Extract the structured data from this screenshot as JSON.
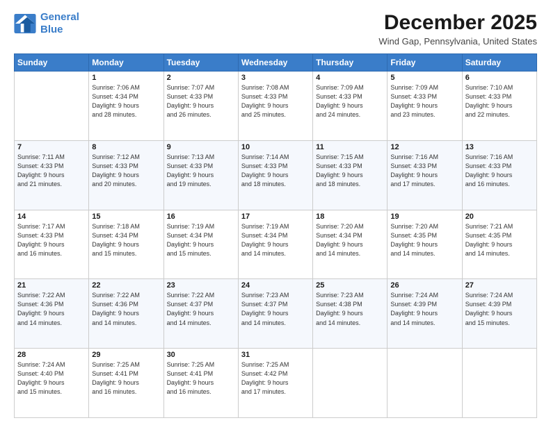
{
  "logo": {
    "line1": "General",
    "line2": "Blue"
  },
  "title": "December 2025",
  "subtitle": "Wind Gap, Pennsylvania, United States",
  "header_days": [
    "Sunday",
    "Monday",
    "Tuesday",
    "Wednesday",
    "Thursday",
    "Friday",
    "Saturday"
  ],
  "weeks": [
    [
      {
        "num": "",
        "info": ""
      },
      {
        "num": "1",
        "info": "Sunrise: 7:06 AM\nSunset: 4:34 PM\nDaylight: 9 hours\nand 28 minutes."
      },
      {
        "num": "2",
        "info": "Sunrise: 7:07 AM\nSunset: 4:33 PM\nDaylight: 9 hours\nand 26 minutes."
      },
      {
        "num": "3",
        "info": "Sunrise: 7:08 AM\nSunset: 4:33 PM\nDaylight: 9 hours\nand 25 minutes."
      },
      {
        "num": "4",
        "info": "Sunrise: 7:09 AM\nSunset: 4:33 PM\nDaylight: 9 hours\nand 24 minutes."
      },
      {
        "num": "5",
        "info": "Sunrise: 7:09 AM\nSunset: 4:33 PM\nDaylight: 9 hours\nand 23 minutes."
      },
      {
        "num": "6",
        "info": "Sunrise: 7:10 AM\nSunset: 4:33 PM\nDaylight: 9 hours\nand 22 minutes."
      }
    ],
    [
      {
        "num": "7",
        "info": "Sunrise: 7:11 AM\nSunset: 4:33 PM\nDaylight: 9 hours\nand 21 minutes."
      },
      {
        "num": "8",
        "info": "Sunrise: 7:12 AM\nSunset: 4:33 PM\nDaylight: 9 hours\nand 20 minutes."
      },
      {
        "num": "9",
        "info": "Sunrise: 7:13 AM\nSunset: 4:33 PM\nDaylight: 9 hours\nand 19 minutes."
      },
      {
        "num": "10",
        "info": "Sunrise: 7:14 AM\nSunset: 4:33 PM\nDaylight: 9 hours\nand 18 minutes."
      },
      {
        "num": "11",
        "info": "Sunrise: 7:15 AM\nSunset: 4:33 PM\nDaylight: 9 hours\nand 18 minutes."
      },
      {
        "num": "12",
        "info": "Sunrise: 7:16 AM\nSunset: 4:33 PM\nDaylight: 9 hours\nand 17 minutes."
      },
      {
        "num": "13",
        "info": "Sunrise: 7:16 AM\nSunset: 4:33 PM\nDaylight: 9 hours\nand 16 minutes."
      }
    ],
    [
      {
        "num": "14",
        "info": "Sunrise: 7:17 AM\nSunset: 4:33 PM\nDaylight: 9 hours\nand 16 minutes."
      },
      {
        "num": "15",
        "info": "Sunrise: 7:18 AM\nSunset: 4:34 PM\nDaylight: 9 hours\nand 15 minutes."
      },
      {
        "num": "16",
        "info": "Sunrise: 7:19 AM\nSunset: 4:34 PM\nDaylight: 9 hours\nand 15 minutes."
      },
      {
        "num": "17",
        "info": "Sunrise: 7:19 AM\nSunset: 4:34 PM\nDaylight: 9 hours\nand 14 minutes."
      },
      {
        "num": "18",
        "info": "Sunrise: 7:20 AM\nSunset: 4:34 PM\nDaylight: 9 hours\nand 14 minutes."
      },
      {
        "num": "19",
        "info": "Sunrise: 7:20 AM\nSunset: 4:35 PM\nDaylight: 9 hours\nand 14 minutes."
      },
      {
        "num": "20",
        "info": "Sunrise: 7:21 AM\nSunset: 4:35 PM\nDaylight: 9 hours\nand 14 minutes."
      }
    ],
    [
      {
        "num": "21",
        "info": "Sunrise: 7:22 AM\nSunset: 4:36 PM\nDaylight: 9 hours\nand 14 minutes."
      },
      {
        "num": "22",
        "info": "Sunrise: 7:22 AM\nSunset: 4:36 PM\nDaylight: 9 hours\nand 14 minutes."
      },
      {
        "num": "23",
        "info": "Sunrise: 7:22 AM\nSunset: 4:37 PM\nDaylight: 9 hours\nand 14 minutes."
      },
      {
        "num": "24",
        "info": "Sunrise: 7:23 AM\nSunset: 4:37 PM\nDaylight: 9 hours\nand 14 minutes."
      },
      {
        "num": "25",
        "info": "Sunrise: 7:23 AM\nSunset: 4:38 PM\nDaylight: 9 hours\nand 14 minutes."
      },
      {
        "num": "26",
        "info": "Sunrise: 7:24 AM\nSunset: 4:39 PM\nDaylight: 9 hours\nand 14 minutes."
      },
      {
        "num": "27",
        "info": "Sunrise: 7:24 AM\nSunset: 4:39 PM\nDaylight: 9 hours\nand 15 minutes."
      }
    ],
    [
      {
        "num": "28",
        "info": "Sunrise: 7:24 AM\nSunset: 4:40 PM\nDaylight: 9 hours\nand 15 minutes."
      },
      {
        "num": "29",
        "info": "Sunrise: 7:25 AM\nSunset: 4:41 PM\nDaylight: 9 hours\nand 16 minutes."
      },
      {
        "num": "30",
        "info": "Sunrise: 7:25 AM\nSunset: 4:41 PM\nDaylight: 9 hours\nand 16 minutes."
      },
      {
        "num": "31",
        "info": "Sunrise: 7:25 AM\nSunset: 4:42 PM\nDaylight: 9 hours\nand 17 minutes."
      },
      {
        "num": "",
        "info": ""
      },
      {
        "num": "",
        "info": ""
      },
      {
        "num": "",
        "info": ""
      }
    ]
  ]
}
